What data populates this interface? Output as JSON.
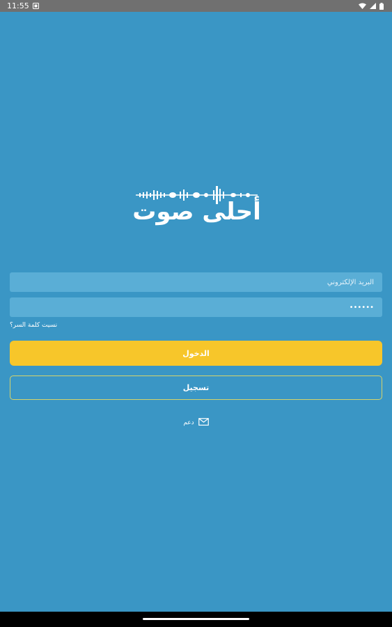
{
  "status_bar": {
    "time": "11:55"
  },
  "logo": {
    "text": "أحلى صوت"
  },
  "login_form": {
    "email_placeholder": "البريد الإلكتروني",
    "password_value": "••••••",
    "forgot_password": "نسيت كلمة السر؟",
    "login_label": "الدخول",
    "register_label": "تسجيل"
  },
  "support": {
    "label": "دعم"
  },
  "colors": {
    "background": "#3a96c5",
    "field": "#5aaed6",
    "login_button": "#f7c62a",
    "register_border": "#d6d46a"
  }
}
